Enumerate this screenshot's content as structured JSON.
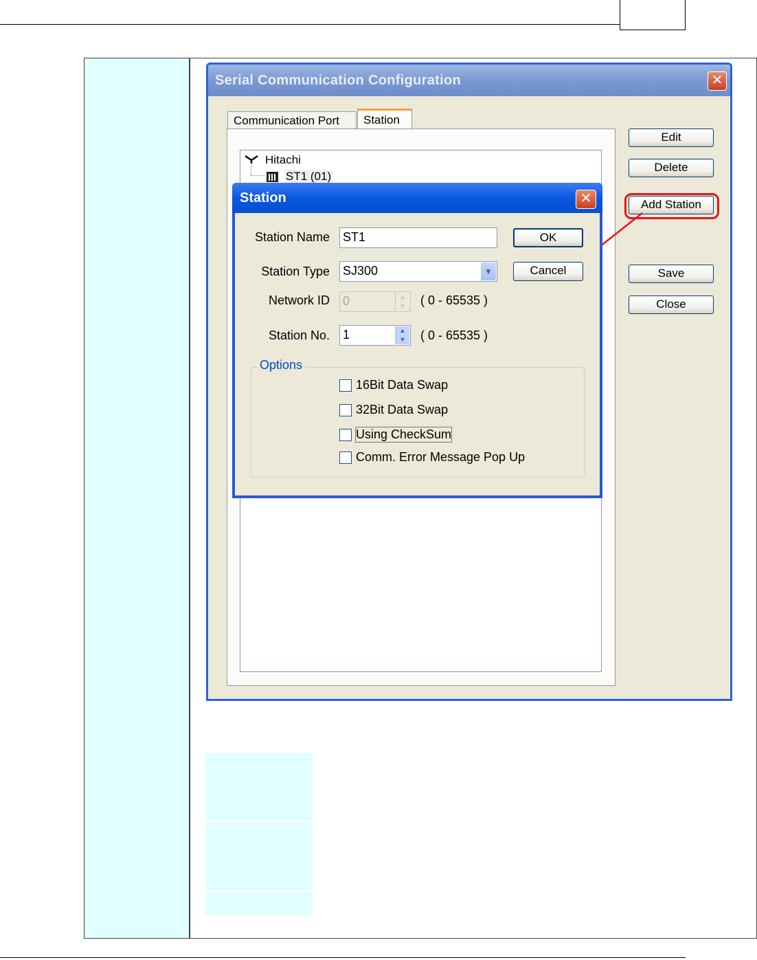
{
  "outer_dialog": {
    "title": "Serial Communication Configuration",
    "close_glyph": "✕",
    "tabs": [
      {
        "label": "Communication Port",
        "selected": false
      },
      {
        "label": "Station",
        "selected": true
      }
    ],
    "tree": {
      "root": "Hitachi",
      "child": "ST1 (01)"
    },
    "buttons": {
      "edit": "Edit",
      "delete": "Delete",
      "add_station": "Add Station",
      "save": "Save",
      "close": "Close"
    }
  },
  "station_dialog": {
    "title": "Station",
    "close_glyph": "✕",
    "station_name_label": "Station Name",
    "station_name_value": "ST1",
    "station_type_label": "Station Type",
    "station_type_value": "SJ300",
    "network_id_label": "Network ID",
    "network_id_value": "0",
    "network_id_range": "( 0 - 65535 )",
    "station_no_label": "Station No.",
    "station_no_value": "1",
    "station_no_range": "( 0 - 65535 )",
    "ok_label": "OK",
    "cancel_label": "Cancel",
    "options_legend": "Options",
    "options": [
      {
        "label": "16Bit Data Swap",
        "checked": false
      },
      {
        "label": "32Bit Data Swap",
        "checked": false
      },
      {
        "label": "Using CheckSum",
        "checked": false
      },
      {
        "label": "Comm. Error Message Pop Up",
        "checked": false
      }
    ]
  },
  "colors": {
    "annotation": "#e8141c",
    "cell_background": "#e0ffff",
    "xp_titlebar": "#0550d4"
  }
}
